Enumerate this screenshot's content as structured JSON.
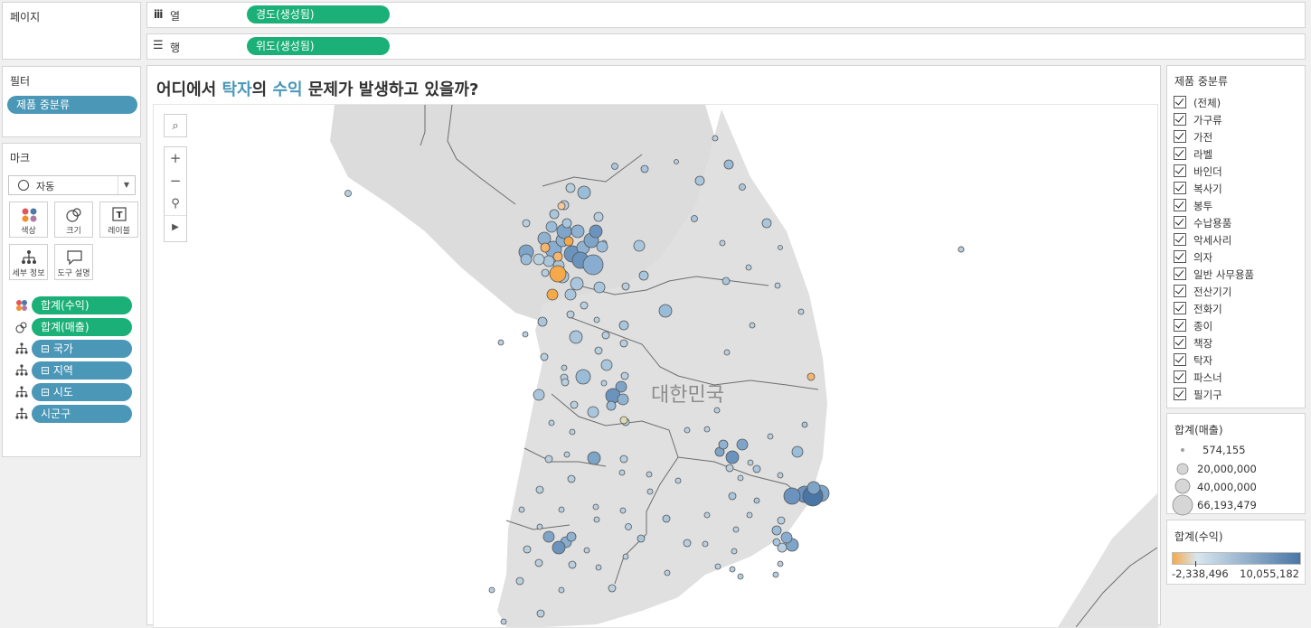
{
  "pages_panel": {
    "title": "페이지"
  },
  "filters_panel": {
    "title": "필터",
    "pill": "제품 중분류"
  },
  "marks_panel": {
    "title": "마크",
    "mark_type": "자동",
    "buttons": {
      "color": "색상",
      "size": "크기",
      "label": "레이블",
      "detail": "세부 정보",
      "tooltip": "도구 설명"
    },
    "fields": [
      "합계(수익)",
      "합계(매출)",
      "⊟ 국가",
      "⊟ 지역",
      "⊟ 시도",
      "시군구"
    ]
  },
  "columns_shelf": {
    "label": "열",
    "pill": "경도(생성됨)"
  },
  "rows_shelf": {
    "label": "행",
    "pill": "위도(생성됨)"
  },
  "view": {
    "title_parts": [
      "어디에서 ",
      "탁자",
      "의 ",
      "수익",
      " 문제가 발생하고 있을까?"
    ],
    "map_label": "대한민국"
  },
  "category_filter": {
    "title": "제품 중분류",
    "items": [
      "(전체)",
      "가구류",
      "가전",
      "라벨",
      "바인더",
      "복사기",
      "봉투",
      "수납용품",
      "악세사리",
      "의자",
      "일반 사무용품",
      "전산기기",
      "전화기",
      "종이",
      "책장",
      "탁자",
      "파스너",
      "필기구"
    ]
  },
  "size_legend": {
    "title": "합계(매출)",
    "entries": [
      "574,155",
      "20,000,000",
      "40,000,000",
      "66,193,479"
    ]
  },
  "color_legend": {
    "title": "합계(수익)",
    "min": "-2,338,496",
    "max": "10,055,182",
    "low_color": "#f6a94b",
    "mid_color": "#d8e6ef",
    "high_color": "#4a76a6"
  }
}
